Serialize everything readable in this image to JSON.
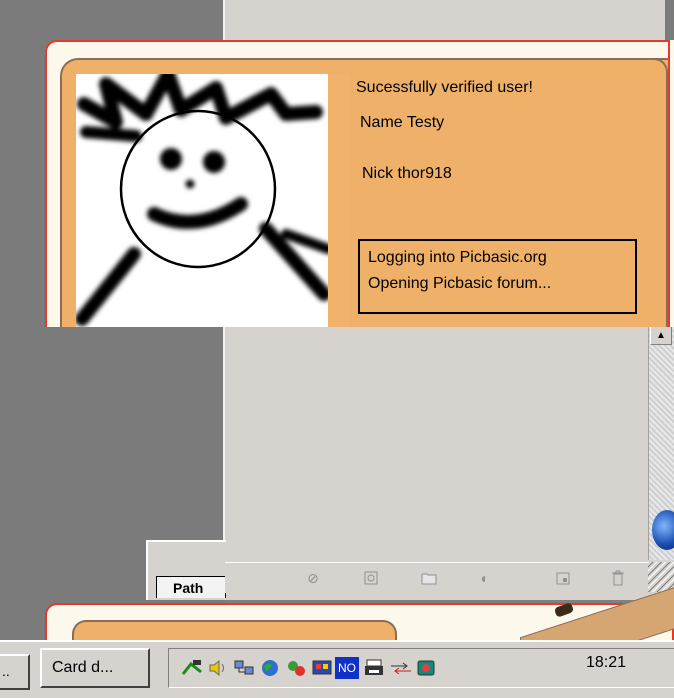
{
  "popup": {
    "line1": "Sucessfully verified user!",
    "line2": "Name Testy",
    "line3": "Nick thor918",
    "status1": "Logging into Picbasic.org",
    "status2": "Opening Picbasic forum..."
  },
  "palette": {
    "tab_label": "Path"
  },
  "taskbar": {
    "partial_label": "..",
    "button_label": "Card d...",
    "clock": "18:21",
    "tray_no_label": "NO"
  },
  "toolbar_icons": [
    "brush-icon",
    "circle-icon",
    "folder-icon",
    "eraser-icon",
    "new-layer-icon",
    "trash-icon"
  ],
  "tray_icons": [
    "network-cable-icon",
    "volume-icon",
    "lan-icon",
    "globe-icon",
    "update-icon",
    "display-icon",
    "no-icon",
    "printer-icon",
    "sync-arrows-icon",
    "card-icon"
  ],
  "colors": {
    "popup_border": "#e23a2c",
    "card_bg": "#efb06a",
    "desktop": "#7b7b7b",
    "window": "#d6d3ce"
  }
}
